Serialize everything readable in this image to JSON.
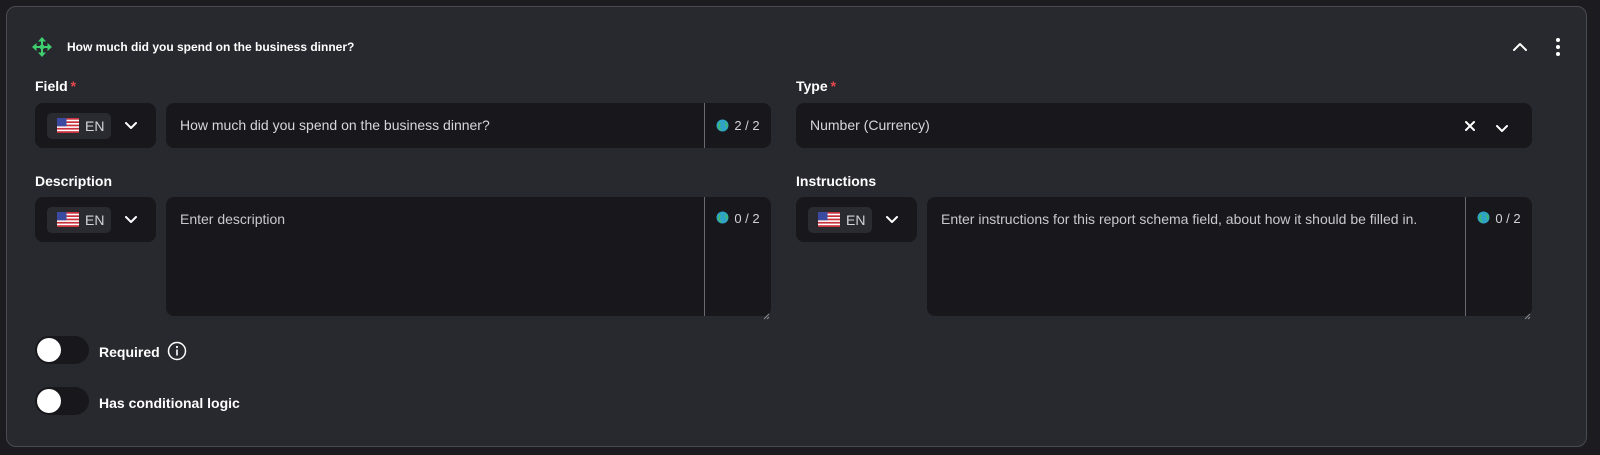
{
  "header": {
    "title": "How much did you spend on the business dinner?",
    "icons": {
      "move": "move-arrows-icon",
      "collapse": "chevron-up-icon",
      "menu": "vertical-ellipsis-icon"
    }
  },
  "field": {
    "label": "Field",
    "required_mark": "*",
    "lang": "EN",
    "value": "How much did you spend on the business dinner?",
    "counter": "2 / 2"
  },
  "type": {
    "label": "Type",
    "required_mark": "*",
    "value": "Number (Currency)"
  },
  "description": {
    "label": "Description",
    "lang": "EN",
    "placeholder": "Enter description",
    "counter": "0 / 2"
  },
  "instructions": {
    "label": "Instructions",
    "lang": "EN",
    "placeholder": "Enter instructions for this report schema field, about how it should be filled in.",
    "counter": "0 / 2"
  },
  "toggles": {
    "required": {
      "label": "Required",
      "on": false
    },
    "conditional": {
      "label": "Has conditional logic",
      "on": false
    }
  },
  "colors": {
    "accent_move_icon": "#3ecf6e",
    "required_star": "#e5484d",
    "card_bg": "#28282f",
    "input_bg": "#18181c"
  }
}
